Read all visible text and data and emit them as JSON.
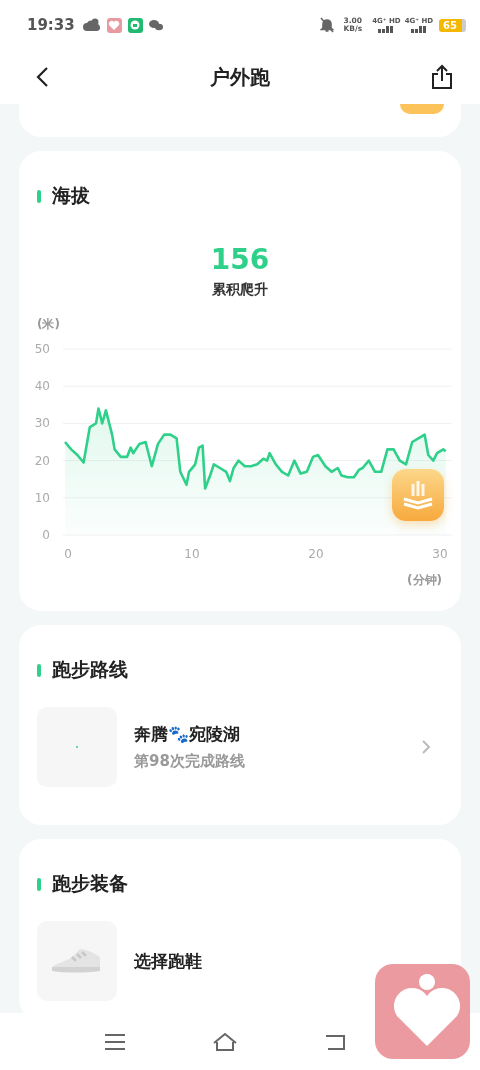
{
  "status_bar": {
    "time": "19:33",
    "speed_value": "3.00",
    "speed_unit": "KB/s",
    "networks": [
      "4G⁺ HD",
      "4G⁺ HD"
    ],
    "battery": "65"
  },
  "header": {
    "title": "户外跑"
  },
  "altitude": {
    "title": "海拔",
    "value": "156",
    "value_label": "累积爬升",
    "y_unit": "(米)",
    "x_unit": "(分钟)",
    "chart_data": {
      "type": "area",
      "x": [
        0,
        0.5,
        1,
        1.5,
        2,
        2.5,
        2.7,
        3,
        3.3,
        3.8,
        4,
        4.5,
        5,
        5.3,
        5.5,
        6,
        6.5,
        7,
        7.5,
        8,
        8.5,
        9,
        9.3,
        9.8,
        10,
        10.5,
        10.8,
        11.1,
        11.3,
        11.7,
        12,
        12.5,
        13,
        13.3,
        13.6,
        14,
        14.5,
        15,
        15.5,
        16,
        16.3,
        16.5,
        17,
        17.5,
        18,
        18.5,
        19,
        19.5,
        20,
        20.4,
        21,
        21.5,
        22,
        22.3,
        22.8,
        23.3,
        23.7,
        24,
        24.5,
        25,
        25.5,
        26,
        26.5,
        27,
        27.5,
        28,
        28.5,
        29,
        29.3,
        29.7,
        30,
        30.5,
        30.7
      ],
      "series": [
        {
          "color": "#2fd08a",
          "values": [
            25,
            23,
            21.5,
            19.5,
            29,
            30,
            34,
            30,
            33.5,
            27,
            23,
            21,
            21,
            23.5,
            22,
            24.5,
            25,
            18.5,
            24.5,
            27,
            27,
            26,
            17,
            13.5,
            17,
            19,
            23.5,
            24,
            12.5,
            16,
            19,
            18,
            17,
            14.5,
            18,
            20,
            18.5,
            18.5,
            19,
            20.5,
            20,
            22,
            19,
            17,
            16,
            20,
            16.5,
            17,
            21,
            21.5,
            18.5,
            17,
            18,
            16,
            15.5,
            15.5,
            17.5,
            18,
            20,
            17,
            17,
            23,
            23,
            20,
            19,
            25,
            26,
            27,
            21.5,
            20,
            22,
            23,
            22.5
          ]
        }
      ],
      "grid": true,
      "xlim": [
        0,
        30.7
      ],
      "ylim": [
        0,
        50
      ],
      "xticks": [
        0,
        10,
        20,
        30
      ],
      "yticks": [
        0,
        10,
        20,
        30,
        40,
        50
      ]
    }
  },
  "route": {
    "title": "跑步路线",
    "name": "奔腾🐾宛陵湖",
    "subtitle": "第98次完成路线"
  },
  "equipment": {
    "title": "跑步装备",
    "action": "选择跑鞋"
  }
}
